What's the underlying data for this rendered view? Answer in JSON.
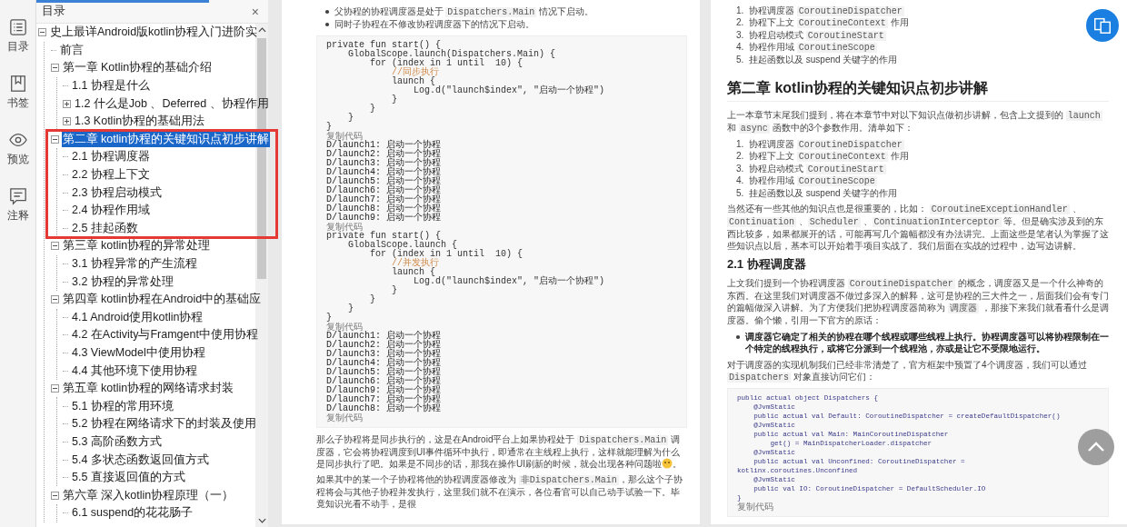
{
  "rail": [
    {
      "label": "目录"
    },
    {
      "label": "书签"
    },
    {
      "label": "预览"
    },
    {
      "label": "注释"
    }
  ],
  "sidebar": {
    "title": "目录",
    "close": "×",
    "tree": [
      {
        "label": "史上最详Android版kotlin协程入门进阶实",
        "expanded": true,
        "selected": false,
        "children": [
          {
            "label": "前言",
            "selected": false
          },
          {
            "label": "第一章 Kotlin协程的基础介绍",
            "expanded": true,
            "selected": false,
            "children": [
              {
                "label": "1.1 协程是什么",
                "selected": false
              },
              {
                "label": "1.2 什么是Job 、Deferred 、协程作用",
                "expanded": false,
                "selected": false
              },
              {
                "label": "1.3 Kotlin协程的基础用法",
                "expanded": false,
                "selected": false
              }
            ]
          },
          {
            "label": "第二章 kotlin协程的关键知识点初步讲解",
            "expanded": true,
            "selected": true,
            "annotated": true,
            "children": [
              {
                "label": "2.1 协程调度器",
                "selected": false
              },
              {
                "label": "2.2 协程上下文",
                "selected": false
              },
              {
                "label": "2.3 协程启动模式",
                "selected": false
              },
              {
                "label": "2.4 协程作用域",
                "selected": false
              },
              {
                "label": "2.5 挂起函数",
                "selected": false
              }
            ]
          },
          {
            "label": "第三章 kotlin协程的异常处理",
            "expanded": true,
            "selected": false,
            "children": [
              {
                "label": "3.1 协程异常的产生流程",
                "selected": false
              },
              {
                "label": "3.2 协程的异常处理",
                "selected": false
              }
            ]
          },
          {
            "label": "第四章 kotlin协程在Android中的基础应",
            "expanded": true,
            "selected": false,
            "children": [
              {
                "label": "4.1 Android使用kotlin协程",
                "selected": false
              },
              {
                "label": "4.2 在Activity与Framgent中使用协程",
                "selected": false
              },
              {
                "label": "4.3 ViewModel中使用协程",
                "selected": false
              },
              {
                "label": "4.4 其他环境下使用协程",
                "selected": false
              }
            ]
          },
          {
            "label": "第五章 kotlin协程的网络请求封装",
            "expanded": true,
            "selected": false,
            "children": [
              {
                "label": "5.1 协程的常用环境",
                "selected": false
              },
              {
                "label": "5.2 协程在网络请求下的封装及使用",
                "selected": false
              },
              {
                "label": "5.3 高阶函数方式",
                "selected": false
              },
              {
                "label": "5.4 多状态函数返回值方式",
                "selected": false
              },
              {
                "label": "5.5 直接返回值的方式",
                "selected": false
              }
            ]
          },
          {
            "label": "第六章 深入kotlin协程原理（一）",
            "expanded": true,
            "selected": false,
            "children": [
              {
                "label": "6.1 suspend的花花肠子",
                "selected": false
              }
            ]
          }
        ]
      }
    ]
  },
  "page_left": {
    "bullets": [
      [
        {
          "kind": "text",
          "text": "父协程的协程调度器是处于 "
        },
        {
          "kind": "code",
          "text": "Dispatchers.Main"
        },
        {
          "kind": "text",
          "text": " 情况下启动。"
        }
      ],
      [
        {
          "kind": "text",
          "text": "同时子协程在不修改协程调度器下的情况下启动。"
        }
      ]
    ],
    "code": [
      {
        "kind": "code",
        "text": "private fun start() {"
      },
      {
        "kind": "code",
        "text": "    GlobalScope.launch(Dispatchers.Main) {"
      },
      {
        "kind": "code",
        "text": "        for (index in 1 until  10) {"
      },
      {
        "kind": "comment",
        "text": "            //同步执行"
      },
      {
        "kind": "code",
        "text": "            launch {"
      },
      {
        "kind": "code",
        "text": "                Log.d(\"launch$index\", \"启动一个协程\")"
      },
      {
        "kind": "code",
        "text": "            }"
      },
      {
        "kind": "code",
        "text": "        }"
      },
      {
        "kind": "code",
        "text": "    }"
      },
      {
        "kind": "code",
        "text": "}"
      },
      {
        "kind": "caption",
        "text": "复制代码"
      },
      {
        "kind": "output",
        "text": "D/launch1: 启动一个协程"
      },
      {
        "kind": "output",
        "text": "D/launch2: 启动一个协程"
      },
      {
        "kind": "output",
        "text": "D/launch3: 启动一个协程"
      },
      {
        "kind": "output",
        "text": "D/launch4: 启动一个协程"
      },
      {
        "kind": "output",
        "text": "D/launch5: 启动一个协程"
      },
      {
        "kind": "output",
        "text": "D/launch6: 启动一个协程"
      },
      {
        "kind": "output",
        "text": "D/launch7: 启动一个协程"
      },
      {
        "kind": "output",
        "text": "D/launch8: 启动一个协程"
      },
      {
        "kind": "output",
        "text": "D/launch9: 启动一个协程"
      },
      {
        "kind": "caption",
        "text": "复制代码"
      },
      {
        "kind": "code",
        "text": "private fun start() {"
      },
      {
        "kind": "code",
        "text": "    GlobalScope.launch {"
      },
      {
        "kind": "code",
        "text": "        for (index in 1 until  10) {"
      },
      {
        "kind": "comment",
        "text": "            //并发执行"
      },
      {
        "kind": "code",
        "text": "            launch {"
      },
      {
        "kind": "code",
        "text": "                Log.d(\"launch$index\", \"启动一个协程\")"
      },
      {
        "kind": "code",
        "text": "            }"
      },
      {
        "kind": "code",
        "text": "        }"
      },
      {
        "kind": "code",
        "text": "    }"
      },
      {
        "kind": "code",
        "text": "}"
      },
      {
        "kind": "caption",
        "text": "复制代码"
      },
      {
        "kind": "output",
        "text": "D/launch1: 启动一个协程"
      },
      {
        "kind": "output",
        "text": "D/launch2: 启动一个协程"
      },
      {
        "kind": "output",
        "text": "D/launch3: 启动一个协程"
      },
      {
        "kind": "output",
        "text": "D/launch4: 启动一个协程"
      },
      {
        "kind": "output",
        "text": "D/launch5: 启动一个协程"
      },
      {
        "kind": "output",
        "text": "D/launch6: 启动一个协程"
      },
      {
        "kind": "output",
        "text": "D/launch9: 启动一个协程"
      },
      {
        "kind": "output",
        "text": "D/launch7: 启动一个协程"
      },
      {
        "kind": "output",
        "text": "D/launch8: 启动一个协程"
      },
      {
        "kind": "caption",
        "text": "复制代码"
      }
    ],
    "paragraphs": [
      {
        "segments": [
          {
            "kind": "text",
            "text": "那么子协程将是同步执行的，这是在Android平台上如果协程处于 "
          },
          {
            "kind": "code",
            "text": "Dispatchers.Main"
          },
          {
            "kind": "text",
            "text": " 调度器，它会将协程调度到UI事件循环中执行，即通常在主线程上执行，这样就能理解为什么是同步执行了吧。如果是不同步的话，那我在操作UI刷新的时候，就会出现各种问题啦"
          }
        ],
        "emoji": true,
        "tail": "。"
      },
      {
        "segments": [
          {
            "kind": "text",
            "text": "如果其中的某一个子协程将他的协程调度器修改为 "
          },
          {
            "kind": "code",
            "text": "非Dispatchers.Main"
          },
          {
            "kind": "text",
            "text": "，那么这个子协程将会与其他子协程并发执行，这里我们就不在演示，各位看官可以自己动手试验一下。毕竟知识光看不动手，是很"
          }
        ]
      }
    ]
  },
  "page_right": {
    "blocks": [
      {
        "kind": "olist",
        "items": [
          {
            "number": "1.",
            "segments": [
              {
                "kind": "text",
                "text": "协程调度器 "
              },
              {
                "kind": "code",
                "text": "CoroutineDispatcher"
              }
            ]
          },
          {
            "number": "2.",
            "segments": [
              {
                "kind": "text",
                "text": "协程下上文 "
              },
              {
                "kind": "code",
                "text": "CoroutineContext"
              },
              {
                "kind": "text",
                "text": " 作用"
              }
            ]
          },
          {
            "number": "3.",
            "segments": [
              {
                "kind": "text",
                "text": "协程启动模式 "
              },
              {
                "kind": "code",
                "text": "CoroutineStart"
              }
            ]
          },
          {
            "number": "4.",
            "segments": [
              {
                "kind": "text",
                "text": "协程作用域 "
              },
              {
                "kind": "code",
                "text": "CoroutineScope"
              }
            ]
          },
          {
            "number": "5.",
            "segments": [
              {
                "kind": "text",
                "text": "挂起函数以及 suspend 关键字的作用"
              }
            ]
          }
        ]
      },
      {
        "kind": "h2",
        "text": "第二章 kotlin协程的关键知识点初步讲解"
      },
      {
        "kind": "para",
        "segments": [
          {
            "kind": "text",
            "text": "上一本章节末尾我们提到，将在本章节中对以下知识点做初步讲解，包含上文提到的 "
          },
          {
            "kind": "code",
            "text": "launch"
          },
          {
            "kind": "text",
            "text": " 和 "
          },
          {
            "kind": "code",
            "text": "async"
          },
          {
            "kind": "text",
            "text": " 函数中的3个参数作用。清单如下："
          }
        ]
      },
      {
        "kind": "olist",
        "items": [
          {
            "number": "1.",
            "segments": [
              {
                "kind": "text",
                "text": "协程调度器 "
              },
              {
                "kind": "code",
                "text": "CoroutineDispatcher"
              }
            ]
          },
          {
            "number": "2.",
            "segments": [
              {
                "kind": "text",
                "text": "协程下上文 "
              },
              {
                "kind": "code",
                "text": "CoroutineContext"
              },
              {
                "kind": "text",
                "text": " 作用"
              }
            ]
          },
          {
            "number": "3.",
            "segments": [
              {
                "kind": "text",
                "text": "协程启动模式 "
              },
              {
                "kind": "code",
                "text": "CoroutineStart"
              }
            ]
          },
          {
            "number": "4.",
            "segments": [
              {
                "kind": "text",
                "text": "协程作用域 "
              },
              {
                "kind": "code",
                "text": "CoroutineScope"
              }
            ]
          },
          {
            "number": "5.",
            "segments": [
              {
                "kind": "text",
                "text": "挂起函数以及 suspend 关键字的作用"
              }
            ]
          }
        ]
      },
      {
        "kind": "para",
        "segments": [
          {
            "kind": "text",
            "text": "当然还有一些其他的知识点也是很重要的，比如： "
          },
          {
            "kind": "code",
            "text": "CoroutineExceptionHandler"
          },
          {
            "kind": "text",
            "text": " 、"
          },
          {
            "kind": "code",
            "text": "Continuation"
          },
          {
            "kind": "text",
            "text": " 、"
          },
          {
            "kind": "code",
            "text": "Scheduler"
          },
          {
            "kind": "text",
            "text": " 、"
          },
          {
            "kind": "code",
            "text": "ContinuationInterceptor"
          },
          {
            "kind": "text",
            "text": " 等。但是确实涉及到的东西比较多，如果都展开的话，可能再写几个篇幅都没有办法讲完。上面这些是笔者认为掌握了这些知识点以后，基本可以开始着手项目实战了。我们后面在实战的过程中，边写边讲解。"
          }
        ]
      },
      {
        "kind": "h3",
        "text": "2.1 协程调度器"
      },
      {
        "kind": "para",
        "segments": [
          {
            "kind": "text",
            "text": "上文我们提到一个协程调度器 "
          },
          {
            "kind": "code",
            "text": "CoroutineDispatcher"
          },
          {
            "kind": "text",
            "text": " 的概念，调度器又是一个什么神奇的东西。在这里我们对调度器不做过多深入的解释，这可是协程的三大件之一，后面我们会有专门的篇幅做深入讲解。为了方便我们把协程调度器简称为 "
          },
          {
            "kind": "code",
            "text": "调度器"
          },
          {
            "kind": "text",
            "text": " ，那接下来我们就看看什么是调度器。偷个懒，引用一下官方的原话："
          }
        ]
      },
      {
        "kind": "bullet",
        "text": "调度器它确定了相关的协程在哪个线程或哪些线程上执行。协程调度器可以将协程限制在一个特定的线程执行，或将它分派到一个线程池，亦或是让它不受限地运行。"
      },
      {
        "kind": "para",
        "segments": [
          {
            "kind": "text",
            "text": "对于调度器的实现机制我们已经非常清楚了，官方框架中预置了4个调度器，我们可以通过 "
          },
          {
            "kind": "code",
            "text": "Dispatchers"
          },
          {
            "kind": "text",
            "text": " 对象直接访问它们："
          }
        ]
      },
      {
        "kind": "code",
        "lines": [
          {
            "kind": "code",
            "text": "public actual object Dispatchers {"
          },
          {
            "kind": "code",
            "text": "    @JvmStatic"
          },
          {
            "kind": "code",
            "text": "    public actual val Default: CoroutineDispatcher = createDefaultDispatcher()"
          },
          {
            "kind": "code",
            "text": "    @JvmStatic"
          },
          {
            "kind": "code",
            "text": "    public actual val Main: MainCoroutineDispatcher"
          },
          {
            "kind": "code",
            "text": "        get() = MainDispatcherLoader.dispatcher"
          },
          {
            "kind": "code",
            "text": "    @JvmStatic"
          },
          {
            "kind": "code",
            "text": "    public actual val Unconfined: CoroutineDispatcher ="
          },
          {
            "kind": "code",
            "text": "kotlinx.coroutines.Unconfined"
          },
          {
            "kind": "code",
            "text": "    @JvmStatic"
          },
          {
            "kind": "code",
            "text": "    public val IO: CoroutineDispatcher = DefaultScheduler.IO"
          },
          {
            "kind": "code",
            "text": "}"
          },
          {
            "kind": "caption",
            "text": "复制代码"
          }
        ]
      }
    ]
  }
}
